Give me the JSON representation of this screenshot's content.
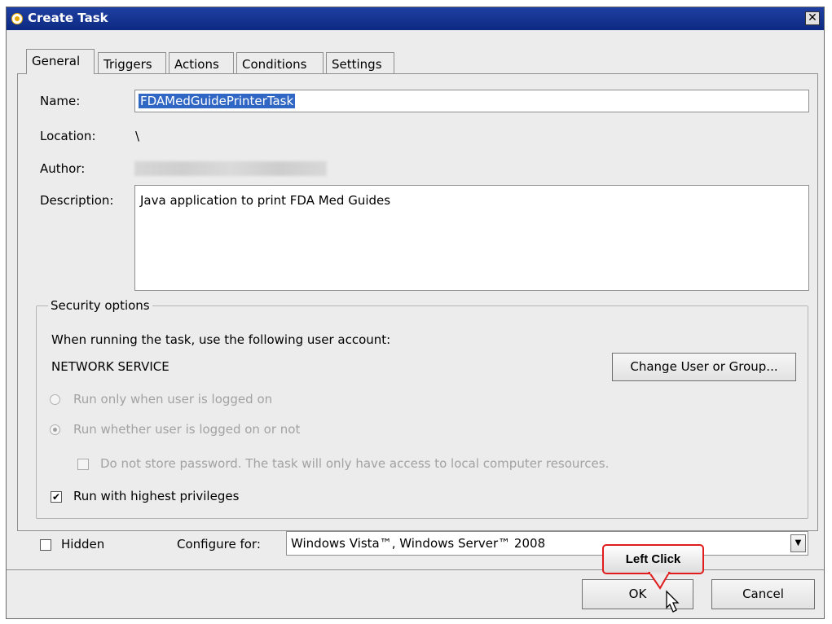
{
  "window": {
    "title": "Create Task",
    "close_glyph": "✕"
  },
  "tabs": [
    {
      "label": "General",
      "active": true
    },
    {
      "label": "Triggers",
      "active": false
    },
    {
      "label": "Actions",
      "active": false
    },
    {
      "label": "Conditions",
      "active": false
    },
    {
      "label": "Settings",
      "active": false
    }
  ],
  "general": {
    "name_label": "Name:",
    "name_value": "FDAMedGuidePrinterTask",
    "location_label": "Location:",
    "location_value": "\\",
    "author_label": "Author:",
    "description_label": "Description:",
    "description_value": "Java application to print FDA Med Guides"
  },
  "security": {
    "legend": "Security options",
    "account_prompt": "When running the task, use the following user account:",
    "account_name": "NETWORK SERVICE",
    "change_button": "Change User or Group...",
    "radio_logged_on": "Run only when user is logged on",
    "radio_whether": "Run whether user is logged on or not",
    "no_store_password": "Do not store password.  The task will only have access to local computer resources.",
    "highest_privileges": "Run with highest privileges",
    "highest_privileges_checked": true
  },
  "footer": {
    "hidden_label": "Hidden",
    "configure_label": "Configure for:",
    "configure_value": "Windows Vista™, Windows Server™ 2008",
    "ok_label": "OK",
    "cancel_label": "Cancel"
  },
  "annotation": {
    "callout_text": "Left Click",
    "callout_color": "#e01c1c"
  },
  "colors": {
    "titlebar": "#1f3fa2",
    "selection": "#3167c4",
    "dialog_bg": "#ececec"
  },
  "icons": {
    "app": "task-scheduler-icon",
    "cursor": "mouse-pointer-icon",
    "dropdown": "chevron-down-icon"
  }
}
